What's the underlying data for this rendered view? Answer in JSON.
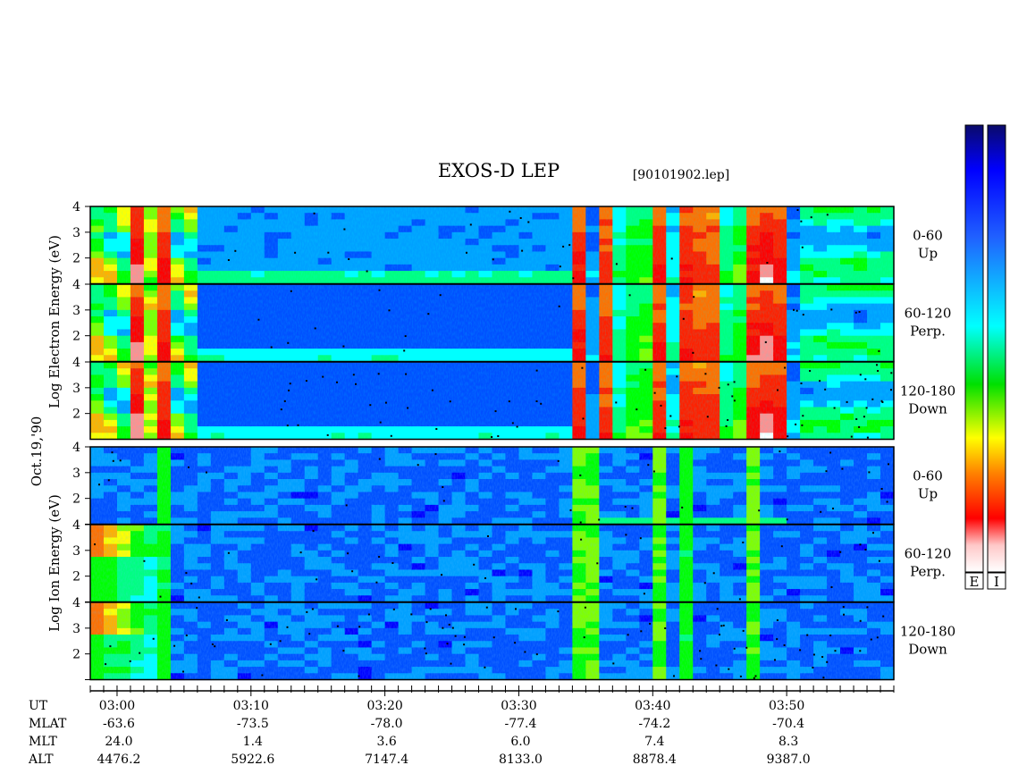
{
  "figure": {
    "title": "EXOS-D LEP",
    "file": "[90101902.lep]",
    "date": "Oct.19,'90"
  },
  "chart_data": {
    "type": "heatmap",
    "title": "EXOS-D LEP",
    "x_axis": {
      "label": "UT",
      "range": [
        "02:58",
        "03:58"
      ],
      "tick_labels": [
        "03:00",
        "03:10",
        "03:20",
        "03:30",
        "03:40",
        "03:50"
      ]
    },
    "ephemeris": [
      {
        "name": "UT",
        "values": [
          "03:00",
          "03:10",
          "03:20",
          "03:30",
          "03:40",
          "03:50"
        ]
      },
      {
        "name": "MLAT",
        "values": [
          "-63.6",
          "-73.5",
          "-78.0",
          "-77.4",
          "-74.2",
          "-70.4"
        ]
      },
      {
        "name": "MLT",
        "values": [
          "24.0",
          "1.4",
          "3.6",
          "6.0",
          "7.4",
          "8.3"
        ]
      },
      {
        "name": "ALT",
        "values": [
          "4476.2",
          "5922.6",
          "7147.4",
          "8133.0",
          "8878.4",
          "9387.0"
        ]
      }
    ],
    "species_labels": {
      "electron": [
        "Log",
        "Electron",
        "Energy",
        "(eV)"
      ],
      "ion": [
        "Log",
        "Ion",
        "Energy",
        "(eV)"
      ]
    },
    "y_axis": {
      "ylim": [
        1,
        4
      ],
      "tick_labels": [
        "4",
        "3",
        "2"
      ],
      "ion_bottom_tick": "1"
    },
    "panels": [
      {
        "species": "electron",
        "pitch": "0-60",
        "dir": "Up"
      },
      {
        "species": "electron",
        "pitch": "60-120",
        "dir": "Perp."
      },
      {
        "species": "electron",
        "pitch": "120-180",
        "dir": "Down"
      },
      {
        "species": "ion",
        "pitch": "0-60",
        "dir": "Up"
      },
      {
        "species": "ion",
        "pitch": "60-120",
        "dir": "Perp."
      },
      {
        "species": "ion",
        "pitch": "120-180",
        "dir": "Down"
      }
    ],
    "colorbars": [
      {
        "label": "E"
      },
      {
        "label": "I"
      }
    ],
    "colorscale": [
      "#0a0a6a",
      "#0000ff",
      "#00ffff",
      "#00ff00",
      "#ffff00",
      "#ff8000",
      "#ff0000",
      "#ffffff"
    ]
  }
}
